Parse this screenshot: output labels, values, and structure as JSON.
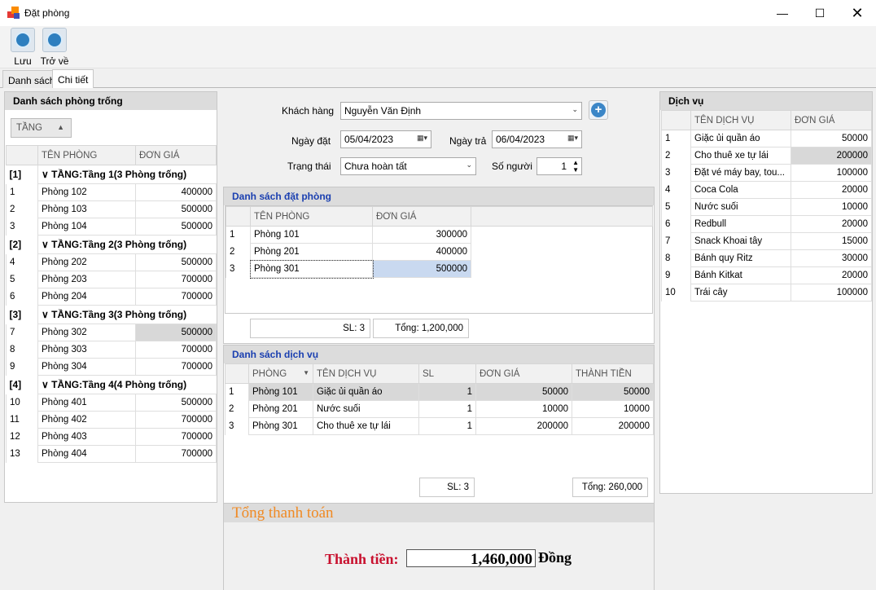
{
  "window": {
    "title": "Đặt phòng"
  },
  "toolbar": {
    "save": "Lưu",
    "back": "Trở về"
  },
  "tabs": [
    "Danh sách",
    "Chi tiết"
  ],
  "rooms_panel": {
    "header": "Danh sách phòng trống",
    "group_button": "TẦNG",
    "columns": [
      "TÊN PHÒNG",
      "ĐƠN GIÁ"
    ],
    "groups": [
      {
        "idx": "[1]",
        "label": "TẦNG:Tầng 1(3 Phòng trống)",
        "rows": [
          [
            "1",
            "Phòng 102",
            "400000"
          ],
          [
            "2",
            "Phòng 103",
            "500000"
          ],
          [
            "3",
            "Phòng 104",
            "500000"
          ]
        ]
      },
      {
        "idx": "[2]",
        "label": "TẦNG:Tầng 2(3 Phòng trống)",
        "rows": [
          [
            "4",
            "Phòng 202",
            "500000"
          ],
          [
            "5",
            "Phòng 203",
            "700000"
          ],
          [
            "6",
            "Phòng 204",
            "700000"
          ]
        ]
      },
      {
        "idx": "[3]",
        "label": "TẦNG:Tầng 3(3 Phòng trống)",
        "rows": [
          [
            "7",
            "Phòng 302",
            "500000"
          ],
          [
            "8",
            "Phòng 303",
            "700000"
          ],
          [
            "9",
            "Phòng 304",
            "700000"
          ]
        ]
      },
      {
        "idx": "[4]",
        "label": "TẦNG:Tầng 4(4 Phòng trống)",
        "rows": [
          [
            "10",
            "Phòng 401",
            "500000"
          ],
          [
            "11",
            "Phòng 402",
            "700000"
          ],
          [
            "12",
            "Phòng 403",
            "700000"
          ],
          [
            "13",
            "Phòng 404",
            "700000"
          ]
        ]
      }
    ]
  },
  "form": {
    "customer_label": "Khách hàng",
    "customer": "Nguyễn Văn Định",
    "checkin_label": "Ngày đặt",
    "checkin": "05/04/2023",
    "checkout_label": "Ngày trả",
    "checkout": "06/04/2023",
    "status_label": "Trạng thái",
    "status": "Chưa hoàn tất",
    "people_label": "Số người",
    "people": "1"
  },
  "booking": {
    "header": "Danh sách đặt phòng",
    "columns": [
      "TÊN PHÒNG",
      "ĐƠN GIÁ"
    ],
    "rows": [
      [
        "1",
        "Phòng 101",
        "300000"
      ],
      [
        "2",
        "Phòng 201",
        "400000"
      ],
      [
        "3",
        "Phòng 301",
        "500000"
      ]
    ],
    "count": "SL: 3",
    "total": "Tổng: 1,200,000"
  },
  "services_used": {
    "header": "Danh sách dịch vụ",
    "columns": [
      "PHÒNG",
      "TÊN DỊCH VỤ",
      "SL",
      "ĐƠN GIÁ",
      "THÀNH TIỀN"
    ],
    "rows": [
      [
        "1",
        "Phòng 101",
        "Giặc ủi quần áo",
        "1",
        "50000",
        "50000"
      ],
      [
        "2",
        "Phòng 201",
        "Nước suối",
        "1",
        "10000",
        "10000"
      ],
      [
        "3",
        "Phòng 301",
        "Cho thuê xe tự lái",
        "1",
        "200000",
        "200000"
      ]
    ],
    "count": "SL:  3",
    "total": "Tổng: 260,000"
  },
  "payment": {
    "header": "Tổng thanh toán",
    "label": "Thành tiền:",
    "value": "1,460,000",
    "currency": "Đồng"
  },
  "services_panel": {
    "header": "Dịch vụ",
    "columns": [
      "TÊN DỊCH VỤ",
      "ĐƠN GIÁ"
    ],
    "rows": [
      [
        "1",
        "Giặc ủi quần áo",
        "50000"
      ],
      [
        "2",
        "Cho thuê xe tự lái",
        "200000"
      ],
      [
        "3",
        "Đặt vé máy bay, tou...",
        "100000"
      ],
      [
        "4",
        "Coca Cola",
        "20000"
      ],
      [
        "5",
        "Nước suối",
        "10000"
      ],
      [
        "6",
        "Redbull",
        "20000"
      ],
      [
        "7",
        "Snack Khoai tây",
        "15000"
      ],
      [
        "8",
        "Bánh quy Ritz",
        "30000"
      ],
      [
        "9",
        "Bánh Kitkat",
        "20000"
      ],
      [
        "10",
        "Trái cây",
        "100000"
      ]
    ]
  }
}
